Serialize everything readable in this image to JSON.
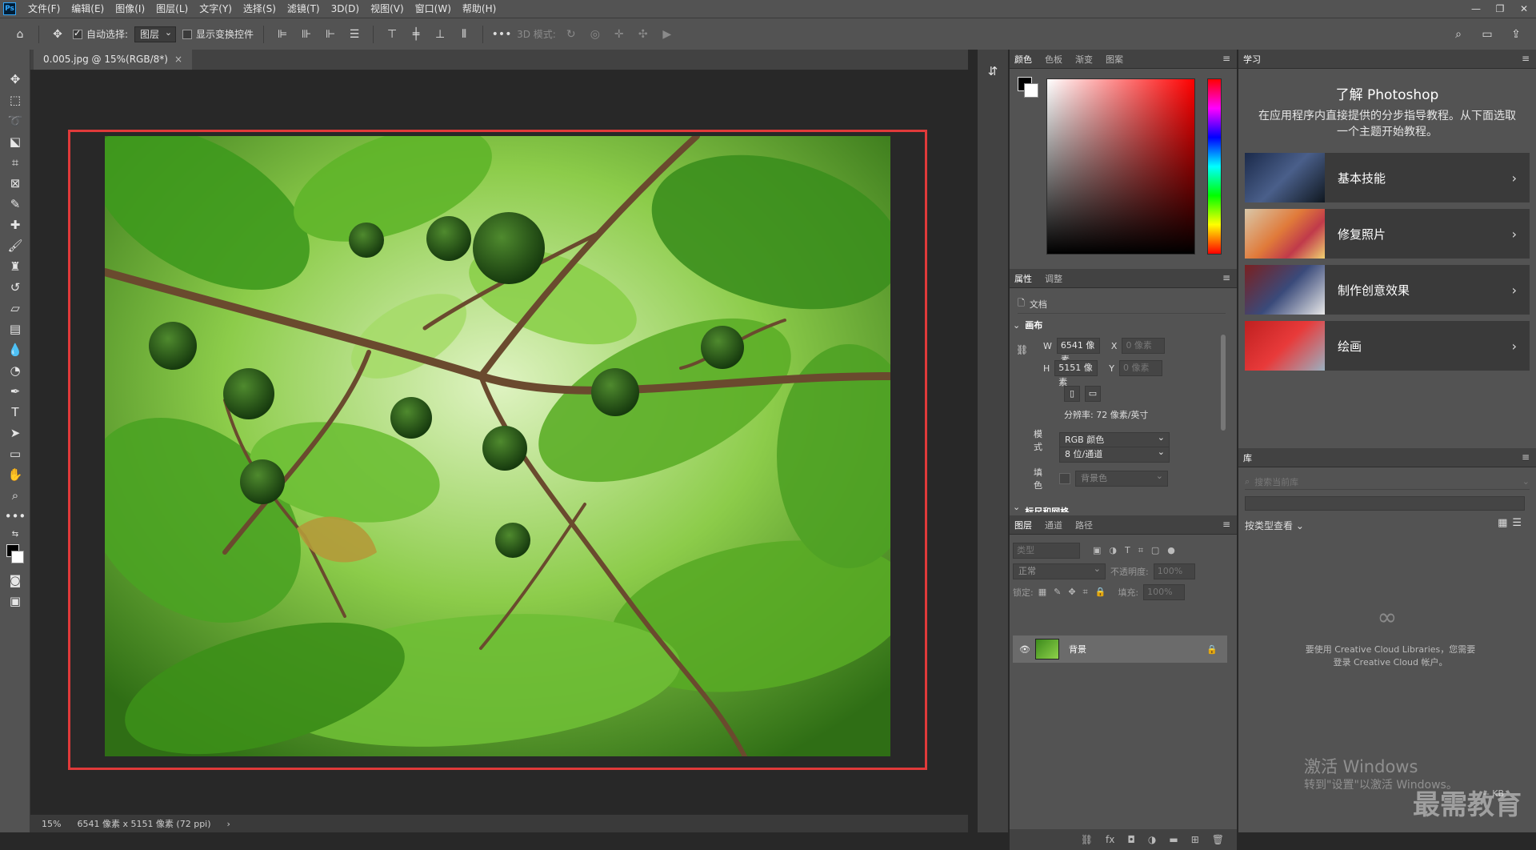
{
  "menu": [
    "文件(F)",
    "编辑(E)",
    "图像(I)",
    "图层(L)",
    "文字(Y)",
    "选择(S)",
    "滤镜(T)",
    "3D(D)",
    "视图(V)",
    "窗口(W)",
    "帮助(H)"
  ],
  "options": {
    "auto_select_label": "自动选择:",
    "auto_select_value": "图层",
    "show_transform_label": "显示变换控件",
    "mode_3d_label": "3D 模式:"
  },
  "document": {
    "tab_label": "0.005.jpg @ 15%(RGB/8*)",
    "zoom": "15%",
    "info": "6541 像素 x 5151 像素 (72 ppi)"
  },
  "color_panel": {
    "tabs": [
      "颜色",
      "色板",
      "渐变",
      "图案"
    ]
  },
  "properties": {
    "tabs": [
      "属性",
      "调整"
    ],
    "doc_label": "文档",
    "canvas_section": "画布",
    "w_label": "W",
    "w_value": "6541 像素",
    "h_label": "H",
    "h_value": "5151 像素",
    "x_label": "X",
    "x_value": "0 像素",
    "y_label": "Y",
    "y_value": "0 像素",
    "resolution": "分辨率: 72 像素/英寸",
    "mode_label": "模式",
    "mode_value": "RGB 颜色",
    "depth_value": "8 位/通道",
    "fill_label": "填色",
    "fill_value": "背景色",
    "next_section": "标尺和网格"
  },
  "layers": {
    "tabs": [
      "图层",
      "通道",
      "路径"
    ],
    "filter_placeholder": "类型",
    "blend_mode": "正常",
    "opacity_label": "不透明度:",
    "opacity_value": "100%",
    "lock_label": "锁定:",
    "fill_label": "填充:",
    "fill_value": "100%",
    "layer_name": "背景"
  },
  "learn": {
    "tab": "学习",
    "title": "了解 Photoshop",
    "desc": "在应用程序内直接提供的分步指导教程。从下面选取一个主题开始教程。",
    "cards": [
      "基本技能",
      "修复照片",
      "制作创意效果",
      "绘画"
    ]
  },
  "library": {
    "tab": "库",
    "search_placeholder": "搜索当前库",
    "view_label": "按类型查看",
    "notice": "要使用 Creative Cloud Libraries，您需要登录 Creative Cloud 帐户。",
    "size": "-- KB"
  },
  "watermark": {
    "line1": "激活 Windows",
    "line2": "转到\"设置\"以激活 Windows。",
    "brand": "最需教育"
  }
}
